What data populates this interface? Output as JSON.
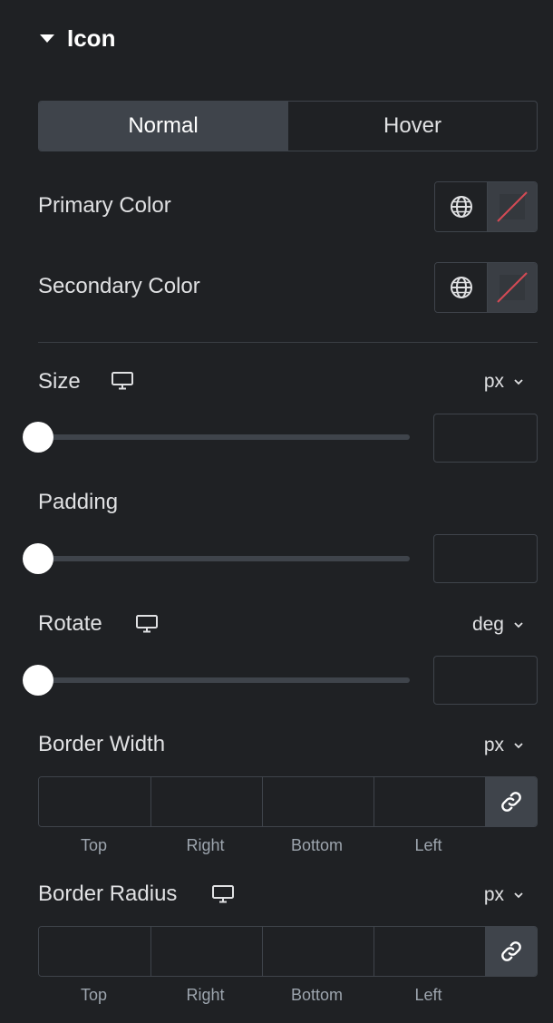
{
  "section": {
    "title": "Icon"
  },
  "tabs": [
    {
      "label": "Normal",
      "active": true
    },
    {
      "label": "Hover",
      "active": false
    }
  ],
  "colors": {
    "primary_label": "Primary Color",
    "secondary_label": "Secondary Color"
  },
  "size": {
    "label": "Size",
    "unit": "px",
    "value": "",
    "slider_fraction": 0
  },
  "padding": {
    "label": "Padding",
    "value": "",
    "slider_fraction": 0
  },
  "rotate": {
    "label": "Rotate",
    "unit": "deg",
    "value": "",
    "slider_fraction": 0
  },
  "border_width": {
    "label": "Border Width",
    "unit": "px",
    "sides": [
      "Top",
      "Right",
      "Bottom",
      "Left"
    ],
    "values": [
      "",
      "",
      "",
      ""
    ]
  },
  "border_radius": {
    "label": "Border Radius",
    "unit": "px",
    "sides": [
      "Top",
      "Right",
      "Bottom",
      "Left"
    ],
    "values": [
      "",
      "",
      "",
      ""
    ]
  },
  "style": {
    "bg": "#1f2124",
    "control_border": "#3f444b",
    "swatch_slash": "#d34a54"
  }
}
